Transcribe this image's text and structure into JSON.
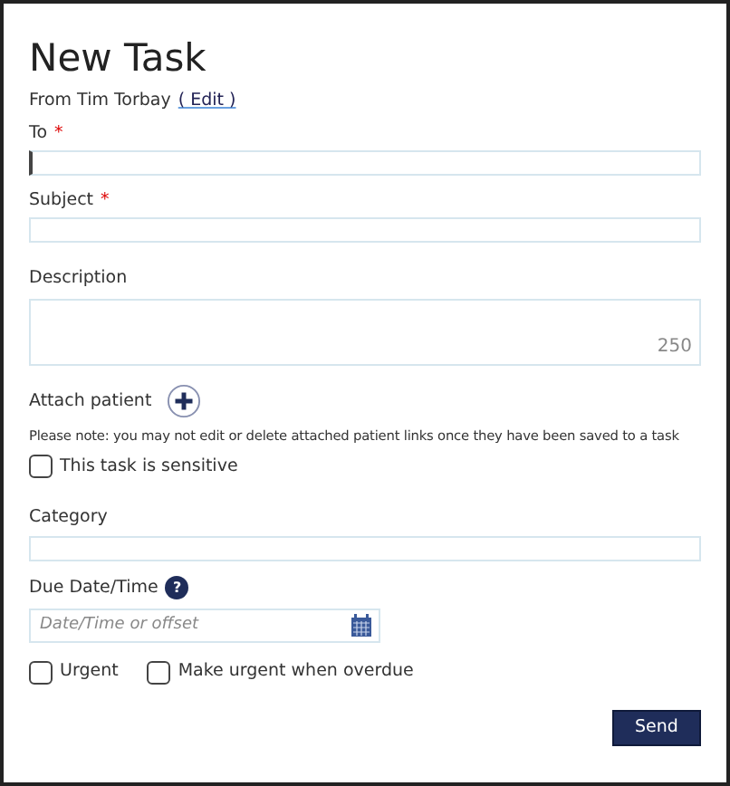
{
  "title": "New Task",
  "from": {
    "text": "From Tim Torbay",
    "link": "( Edit )"
  },
  "to": {
    "label": "To",
    "required_mark": "*",
    "focused": true
  },
  "subject": {
    "label": "Subject",
    "required_mark": "*"
  },
  "description": {
    "label": "Description",
    "counter": "250"
  },
  "attach": {
    "label": "Attach patient",
    "note": "Please note: you may not edit or delete attached patient links once they have been saved to a task"
  },
  "sensitive": {
    "label": "This task is sensitive",
    "checked": false
  },
  "category": {
    "label": "Category"
  },
  "due": {
    "label": "Due Date/Time",
    "help": "?",
    "placeholder": "Date/Time or offset"
  },
  "options": [
    {
      "label": "Urgent",
      "checked": false
    },
    {
      "label": "Make urgent when overdue",
      "checked": false
    }
  ],
  "send": "Send"
}
